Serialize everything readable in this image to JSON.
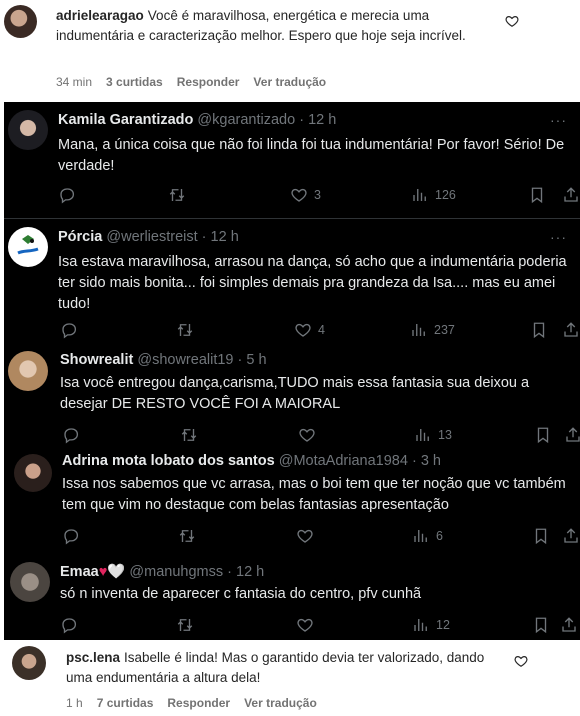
{
  "top_comment": {
    "user": "adrielearagao",
    "text": "Você é maravilhosa, energética e merecia uma indumentária e caracterização melhor. Espero que hoje seja incrível.",
    "time": "34 min",
    "likes": "3 curtidas",
    "reply": "Responder",
    "translate": "Ver tradução"
  },
  "replies": [
    {
      "name": "Kamila Garantizado",
      "handle": "@kgarantizado",
      "dot": "·",
      "time": "12 h",
      "text": "Mana, a única coisa que não foi linda foi tua indumentária! Por favor! Sério! De verdade!",
      "likes": "3",
      "views": "126"
    },
    {
      "name": "Pórcia",
      "handle": "@werliestreist",
      "dot": "·",
      "time": "12 h",
      "text": "Isa estava maravilhosa, arrasou na dança, só acho que a indumentária poderia ter sido mais bonita... foi simples demais pra grandeza da Isa.... mas eu amei tudo!",
      "likes": "4",
      "views": "237"
    },
    {
      "name": "Showrealit",
      "handle": "@showrealit19",
      "dot": "·",
      "time": "5 h",
      "text": "Isa você entregou dança,carisma,TUDO mais essa fantasia sua deixou a desejar DE RESTO VOCÊ FOI A MAIORAL",
      "likes": "",
      "views": "13"
    },
    {
      "name": "Adrina mota lobato dos santos",
      "handle": "@MotaAdriana1984",
      "dot": "·",
      "time": "3 h",
      "text": "Issa nos sabemos que vc arrasa, mas o boi tem que ter noção que vc também tem que vim no destaque  com belas fantasias apresentação",
      "likes": "",
      "views": "6"
    },
    {
      "name": "Emaa",
      "emoji": "♥🤍",
      "handle": "@manuhgmss",
      "dot": "·",
      "time": "12 h",
      "text": "só n inventa de aparecer c fantasia do centro, pfv cunhã",
      "likes": "",
      "views": "12"
    }
  ],
  "bottom_comment": {
    "user": "psc.lena",
    "text": "Isabelle é linda! Mas o garantido devia ter valorizado, dando uma endumentária a altura dela!",
    "time": "1 h",
    "likes": "7 curtidas",
    "reply": "Responder",
    "translate": "Ver tradução"
  },
  "more_glyph": "···",
  "icons": [
    "reply-icon",
    "retweet-icon",
    "heart-icon",
    "views-icon",
    "bookmark-icon",
    "share-icon",
    "more-icon"
  ]
}
